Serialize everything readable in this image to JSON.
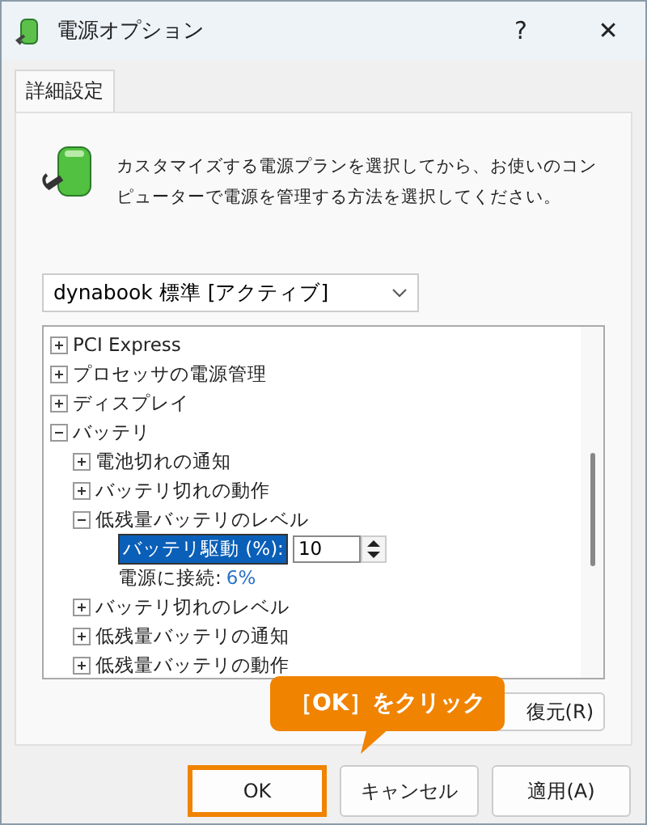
{
  "window": {
    "title": "電源オプション",
    "help": "?",
    "close": "✕"
  },
  "tabs": [
    {
      "label": "詳細設定",
      "selected": true
    }
  ],
  "description": "カスタマイズする電源プランを選択してから、お使いのコンピューターで電源を管理する方法を選択してください。",
  "plan_dropdown": {
    "value": "dynabook 標準 [アクティブ]"
  },
  "tree": [
    {
      "label": "PCI Express",
      "expanded": false
    },
    {
      "label": "プロセッサの電源管理",
      "expanded": false
    },
    {
      "label": "ディスプレイ",
      "expanded": false
    },
    {
      "label": "バッテリ",
      "expanded": true,
      "children": [
        {
          "label": "電池切れの通知",
          "expanded": false
        },
        {
          "label": "バッテリ切れの動作",
          "expanded": false
        },
        {
          "label": "低残量バッテリのレベル",
          "expanded": true,
          "children": [
            {
              "kind": "spinner",
              "label": "バッテリ駆動 (%):",
              "value": "10",
              "selected": true
            },
            {
              "kind": "value",
              "label": "電源に接続:",
              "value": "6%"
            }
          ]
        },
        {
          "label": "バッテリ切れのレベル",
          "expanded": false
        },
        {
          "label": "低残量バッテリの通知",
          "expanded": false
        },
        {
          "label": "低残量バッテリの動作",
          "expanded": false
        }
      ]
    }
  ],
  "restore_button": "復元(R)",
  "callout": "［OK］をクリック",
  "buttons": [
    {
      "label": "OK",
      "highlighted": true
    },
    {
      "label": "キャンセル",
      "highlighted": false
    },
    {
      "label": "適用(A)",
      "highlighted": false
    }
  ]
}
